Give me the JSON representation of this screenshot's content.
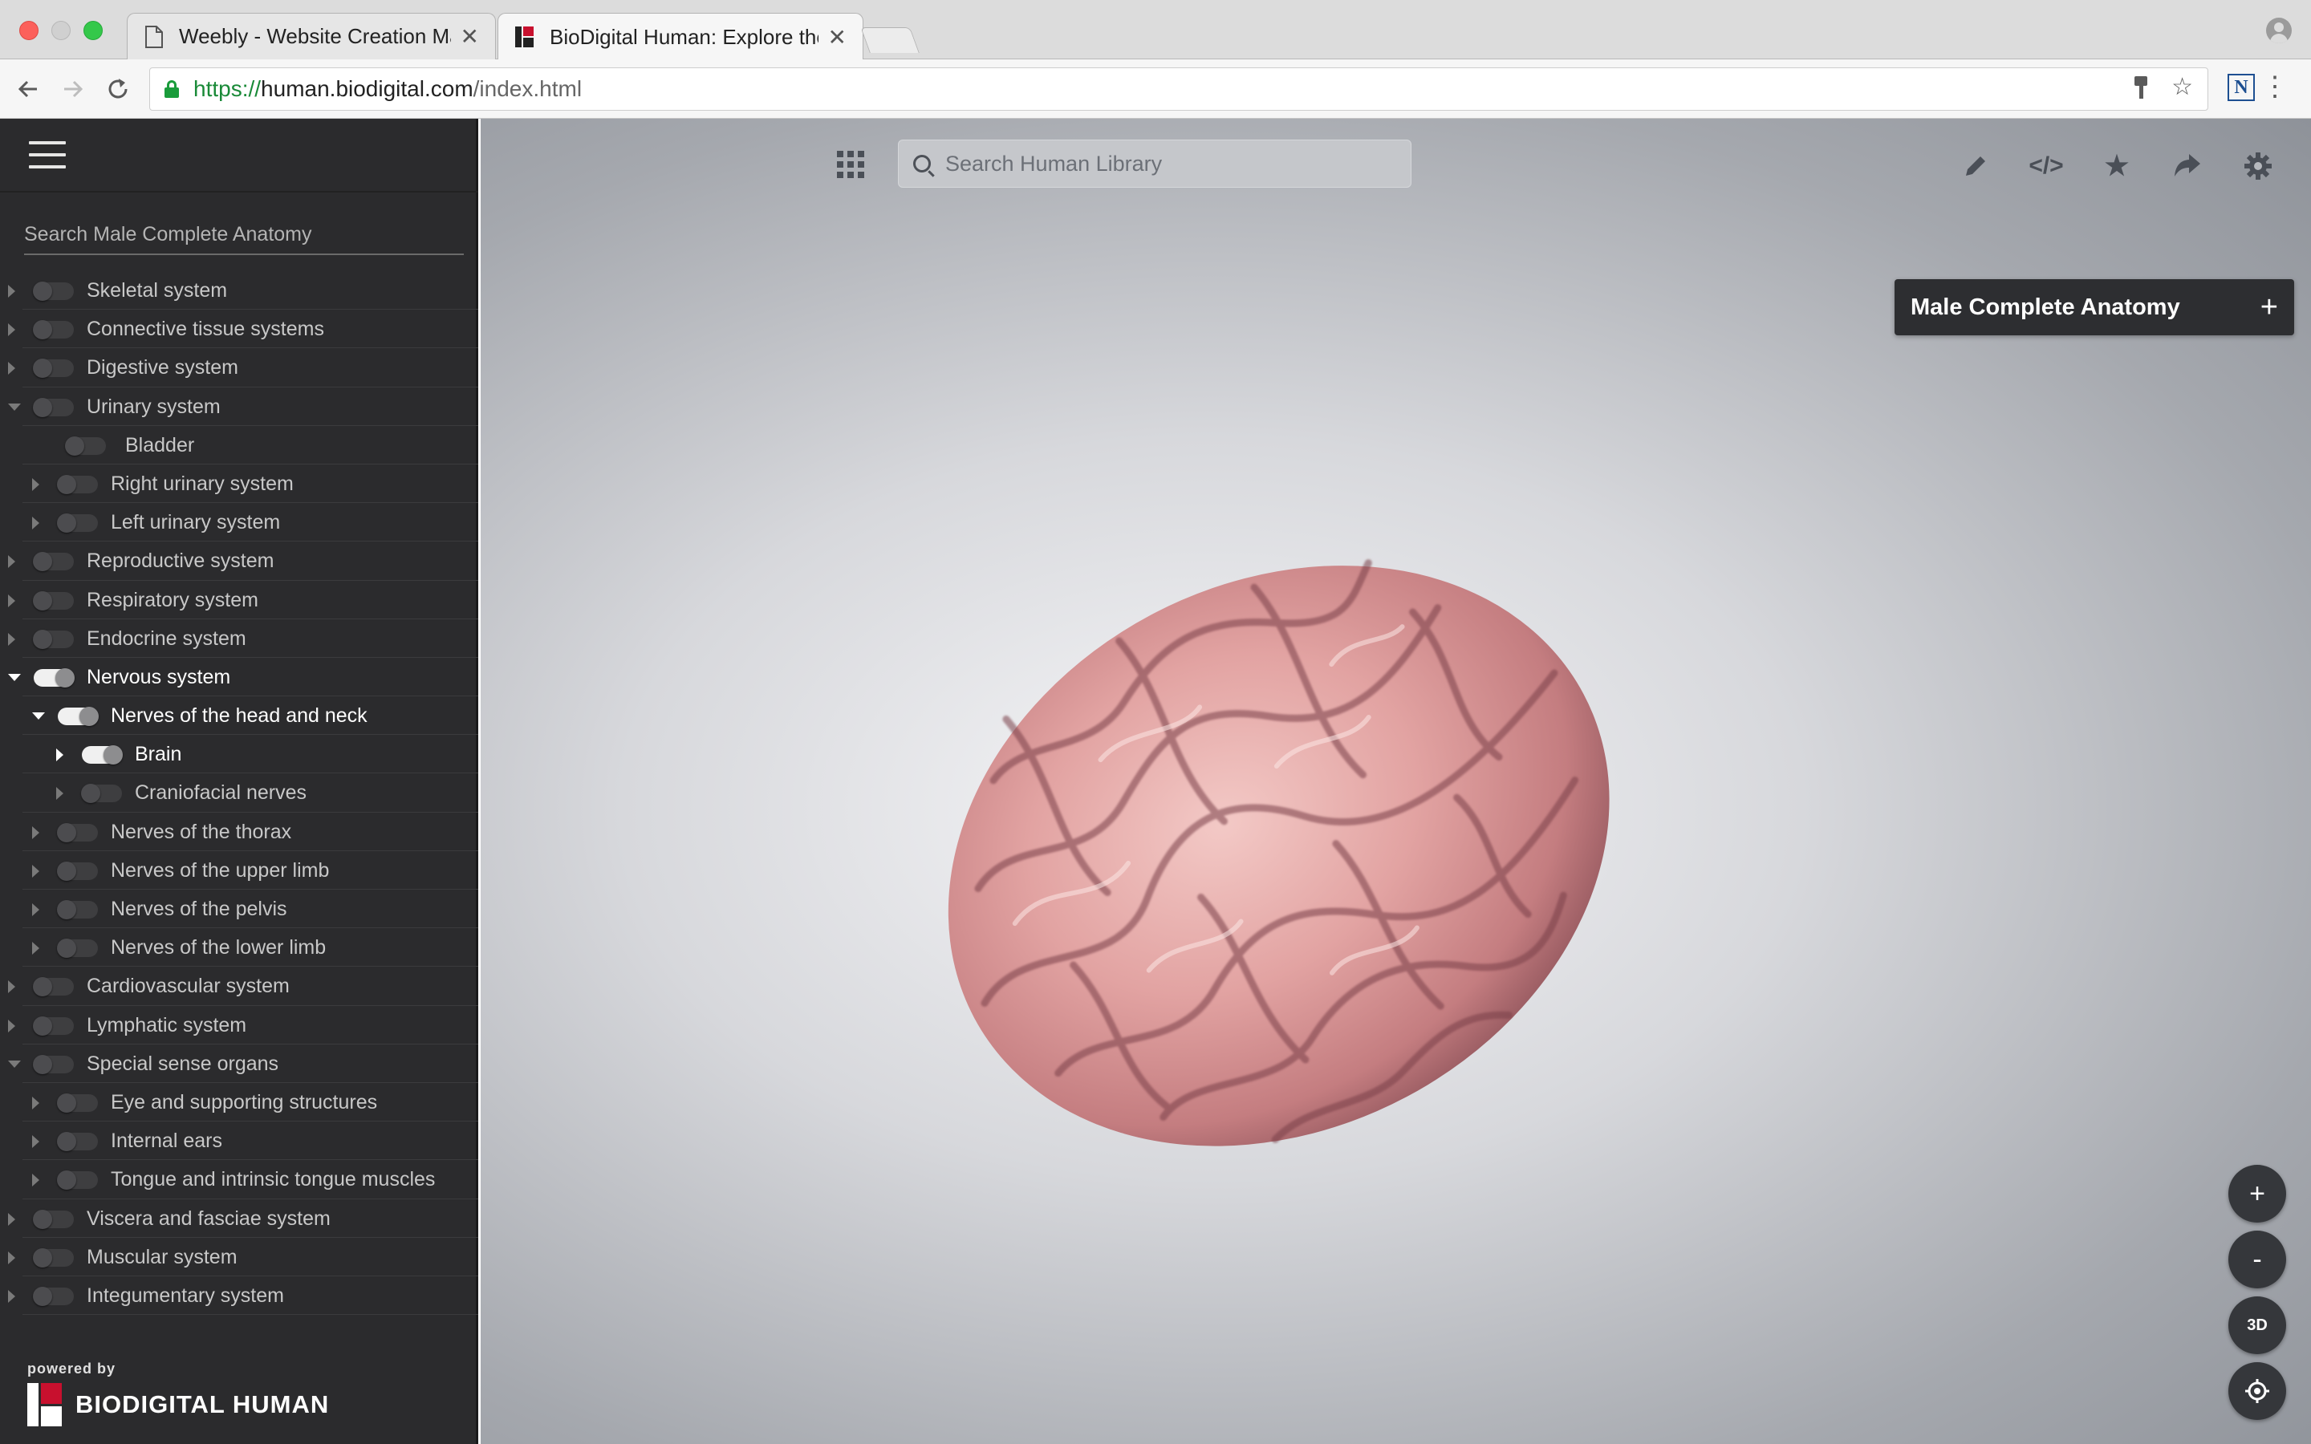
{
  "browser": {
    "tabs": [
      {
        "title": "Weebly - Website Creation Ma",
        "active": false
      },
      {
        "title": "BioDigital Human: Explore the",
        "active": true
      }
    ],
    "url": {
      "scheme": "https://",
      "host": "human.biodigital.com",
      "path": "/index.html"
    }
  },
  "sidebar": {
    "search_placeholder": "Search Male Complete Anatomy",
    "items": [
      {
        "label": "Skeletal system",
        "level": 0,
        "caret": "right",
        "on": false
      },
      {
        "label": "Connective tissue systems",
        "level": 0,
        "caret": "right",
        "on": false
      },
      {
        "label": "Digestive system",
        "level": 0,
        "caret": "right",
        "on": false
      },
      {
        "label": "Urinary system",
        "level": 0,
        "caret": "down",
        "on": false
      },
      {
        "label": "Bladder",
        "level": 1,
        "caret": "none",
        "on": false
      },
      {
        "label": "Right urinary system",
        "level": 1,
        "caret": "right",
        "on": false
      },
      {
        "label": "Left urinary system",
        "level": 1,
        "caret": "right",
        "on": false
      },
      {
        "label": "Reproductive system",
        "level": 0,
        "caret": "right",
        "on": false
      },
      {
        "label": "Respiratory system",
        "level": 0,
        "caret": "right",
        "on": false
      },
      {
        "label": "Endocrine system",
        "level": 0,
        "caret": "right",
        "on": false
      },
      {
        "label": "Nervous system",
        "level": 0,
        "caret": "down",
        "on": true
      },
      {
        "label": "Nerves of the head and neck",
        "level": 1,
        "caret": "down",
        "on": true
      },
      {
        "label": "Brain",
        "level": 2,
        "caret": "right",
        "on": true
      },
      {
        "label": "Craniofacial nerves",
        "level": 2,
        "caret": "right",
        "on": false
      },
      {
        "label": "Nerves of the thorax",
        "level": 1,
        "caret": "right",
        "on": false
      },
      {
        "label": "Nerves of the upper limb",
        "level": 1,
        "caret": "right",
        "on": false
      },
      {
        "label": "Nerves of the pelvis",
        "level": 1,
        "caret": "right",
        "on": false
      },
      {
        "label": "Nerves of the lower limb",
        "level": 1,
        "caret": "right",
        "on": false
      },
      {
        "label": "Cardiovascular system",
        "level": 0,
        "caret": "right",
        "on": false
      },
      {
        "label": "Lymphatic system",
        "level": 0,
        "caret": "right",
        "on": false
      },
      {
        "label": "Special sense organs",
        "level": 0,
        "caret": "down",
        "on": false
      },
      {
        "label": "Eye and supporting structures",
        "level": 1,
        "caret": "right",
        "on": false
      },
      {
        "label": "Internal ears",
        "level": 1,
        "caret": "right",
        "on": false
      },
      {
        "label": "Tongue and intrinsic tongue muscles",
        "level": 1,
        "caret": "right",
        "on": false
      },
      {
        "label": "Viscera and fasciae system",
        "level": 0,
        "caret": "right",
        "on": false
      },
      {
        "label": "Muscular system",
        "level": 0,
        "caret": "right",
        "on": false
      },
      {
        "label": "Integumentary system",
        "level": 0,
        "caret": "right",
        "on": false
      }
    ],
    "powered_by": "powered by",
    "brand": "BIODIGITAL HUMAN"
  },
  "viewer": {
    "search_placeholder": "Search Human Library",
    "panel_title": "Male Complete Anatomy",
    "panel_add": "+",
    "zoom_in": "+",
    "zoom_out": "-",
    "rotate_label": "3D"
  },
  "colors": {
    "sidebar_bg": "#2b2b2d",
    "panel_bg": "#2d2e31",
    "brand_red": "#c8102e",
    "secure_green": "#1a8a38"
  }
}
